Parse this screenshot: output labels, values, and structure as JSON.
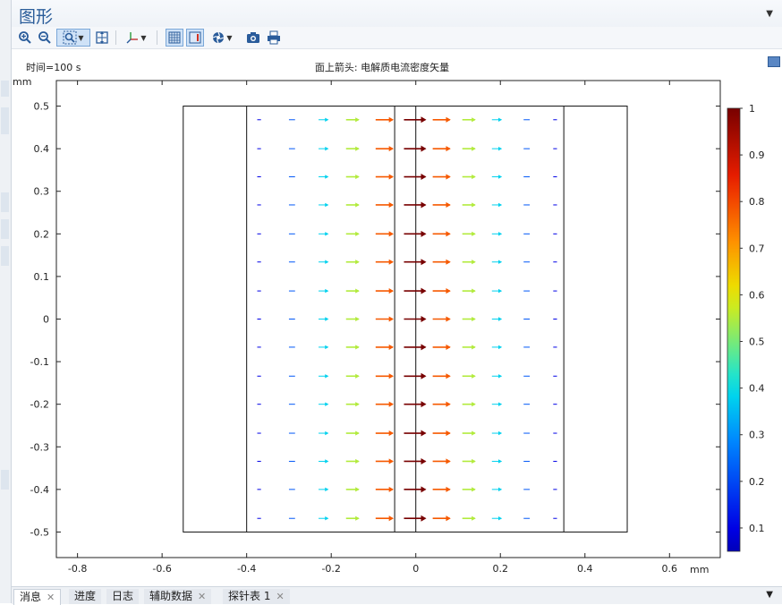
{
  "panel": {
    "title": "图形"
  },
  "toolbar": {
    "zoom_in_icon": "zoom-in-icon",
    "zoom_out_icon": "zoom-out-icon",
    "zoom_box_icon": "zoom-box-icon",
    "zoom_extents_icon": "zoom-extents-icon",
    "axes_icon": "axes-icon",
    "grid_icon": "grid-icon",
    "legend_icon": "legend-icon",
    "scene_light_icon": "scene-light-icon",
    "camera_icon": "camera-icon",
    "print_icon": "print-icon"
  },
  "bottom_tabs": [
    {
      "label": "消息",
      "closable": true,
      "active": true
    },
    {
      "label": "进度",
      "closable": false
    },
    {
      "label": "日志",
      "closable": false
    },
    {
      "label": "辅助数据",
      "closable": true
    },
    {
      "label": "探针表 1",
      "closable": true
    }
  ],
  "chart_data": {
    "type": "quiver",
    "time_label": "时间=100 s",
    "title": "面上箭头: 电解质电流密度矢量",
    "xlabel": "mm",
    "ylabel": "mm",
    "xlim": [
      -0.85,
      0.72
    ],
    "ylim": [
      -0.56,
      0.56
    ],
    "xticks": [
      "-0.8",
      "-0.6",
      "-0.4",
      "-0.2",
      "0",
      "0.2",
      "0.4",
      "0.6"
    ],
    "xtick_values": [
      -0.8,
      -0.6,
      -0.4,
      -0.2,
      0,
      0.2,
      0.4,
      0.6
    ],
    "yticks": [
      "0.5",
      "0.4",
      "0.3",
      "0.2",
      "0.1",
      "0",
      "-0.1",
      "-0.2",
      "-0.3",
      "-0.4",
      "-0.5"
    ],
    "ytick_values": [
      0.5,
      0.4,
      0.3,
      0.2,
      0.1,
      0,
      -0.1,
      -0.2,
      -0.3,
      -0.4,
      -0.5
    ],
    "domain_boundaries": {
      "outer_rect": {
        "x": [
          -0.55,
          0.5
        ],
        "y": [
          -0.5,
          0.5
        ]
      },
      "vertical_lines_x": [
        -0.4,
        -0.05,
        0.0,
        0.35
      ]
    },
    "arrow_columns_x": [
      -0.375,
      -0.3,
      -0.23,
      -0.165,
      -0.095,
      -0.028,
      0.04,
      0.11,
      0.18,
      0.255,
      0.325
    ],
    "arrow_columns_value": [
      0.1,
      0.22,
      0.38,
      0.55,
      0.78,
      1.0,
      0.78,
      0.55,
      0.38,
      0.22,
      0.1
    ],
    "arrow_rows_y": [
      0.468,
      0.4,
      0.334,
      0.268,
      0.2,
      0.134,
      0.066,
      0.0,
      -0.066,
      -0.134,
      -0.2,
      -0.268,
      -0.334,
      -0.4,
      -0.468
    ],
    "colorbar": {
      "ticks": [
        "1",
        "0.9",
        "0.8",
        "0.7",
        "0.6",
        "0.5",
        "0.4",
        "0.3",
        "0.2",
        "0.1"
      ],
      "tick_values": [
        1,
        0.9,
        0.8,
        0.7,
        0.6,
        0.5,
        0.4,
        0.3,
        0.2,
        0.1
      ],
      "range": [
        0.05,
        1.0
      ],
      "colormap": "rainbow"
    }
  }
}
